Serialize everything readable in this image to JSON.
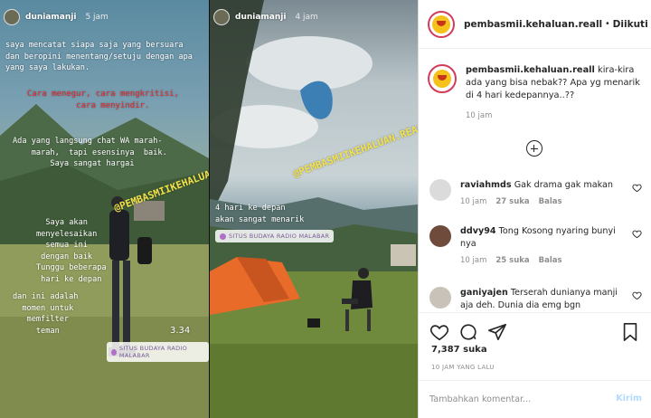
{
  "story1": {
    "username": "duniamanji",
    "time": "5 jam",
    "text_intro": "saya mencatat siapa saja yang bersuara\ndan beropini menentang/setuju dengan apa\nyang saya lakukan.",
    "text_red": "Cara menegur, cara mengkritisi,\n          cara menyindir.",
    "text_middle": "Ada yang langsung chat WA marah-\n    marah,  tapi esensinya  baik.\n        Saya sangat hargai",
    "text_lower": "  Saya akan\nmenyelesaikan\n  semua ini\n dengan baik\nTunggu beberapa\n hari ke depan",
    "text_bottom": "dan ini adalah\n  momen untuk\n   memfilter\n     teman",
    "watermark": "@PEMBASMIIKEHALUAN.REAL",
    "timestamp_overlay": "3.34",
    "location": "SITUS BUDAYA RADIO MALABAR",
    "red_text_color": "#e8262a"
  },
  "story2": {
    "username": "duniamanji",
    "time": "4 jam",
    "watermark": "@PEMBASMIIKEHALUAN.REAL",
    "text_main": "4 hari ke depan\nakan sangat menarik",
    "location": "SITUS BUDAYA RADIO MALABAR"
  },
  "post": {
    "header_username": "pembasmii.kehaluan.reall",
    "header_follow": "Diikuti",
    "caption_username": "pembasmii.kehaluan.reall",
    "caption_text": "kira-kira ada yang bisa nebak?? Apa yg menarik di 4 hari kedepannya..??",
    "caption_time": "10 jam",
    "comments": [
      {
        "username": "raviahmds",
        "text": "Gak drama gak makan",
        "time": "10 jam",
        "likes": "27 suka",
        "reply": "Balas"
      },
      {
        "username": "ddvy94",
        "text": "Tong Kosong nyaring bunyi nya",
        "time": "10 jam",
        "likes": "25 suka",
        "reply": "Balas"
      },
      {
        "username": "ganiyajen",
        "text": "Terserah dunianya manji aja deh. Dunia dia emg bgn",
        "time": "",
        "likes": "",
        "reply": ""
      }
    ],
    "like_count": "7,387 suka",
    "post_date": "10 JAM YANG LALU",
    "comment_placeholder": "Tambahkan komentar...",
    "post_button": "Kirim",
    "accent_color": "#0095f6"
  }
}
